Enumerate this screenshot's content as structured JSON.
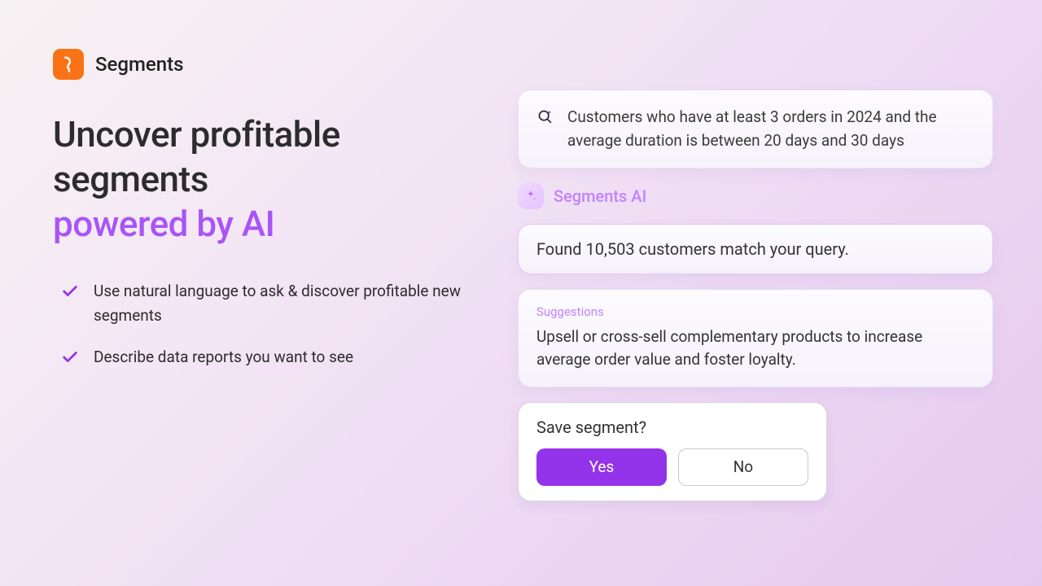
{
  "brand": {
    "name": "Segments"
  },
  "headline": {
    "line1": "Uncover profitable segments",
    "line2": "powered by AI"
  },
  "bullets": [
    "Use natural language to ask & discover profitable new segments",
    "Describe data reports you want to see"
  ],
  "query": "Customers who have at least 3 orders in 2024 and the average duration is between 20 days and 30 days",
  "ai": {
    "label": "Segments AI"
  },
  "result": "Found 10,503 customers match your query.",
  "suggestions": {
    "title": "Suggestions",
    "body": "Upsell or cross-sell complementary products to increase average order value and foster loyalty."
  },
  "save": {
    "title": "Save segment?",
    "yes": "Yes",
    "no": "No"
  },
  "colors": {
    "accent": "#a855f7",
    "primaryBtn": "#9333ea",
    "brandLogo": "#f97316"
  }
}
